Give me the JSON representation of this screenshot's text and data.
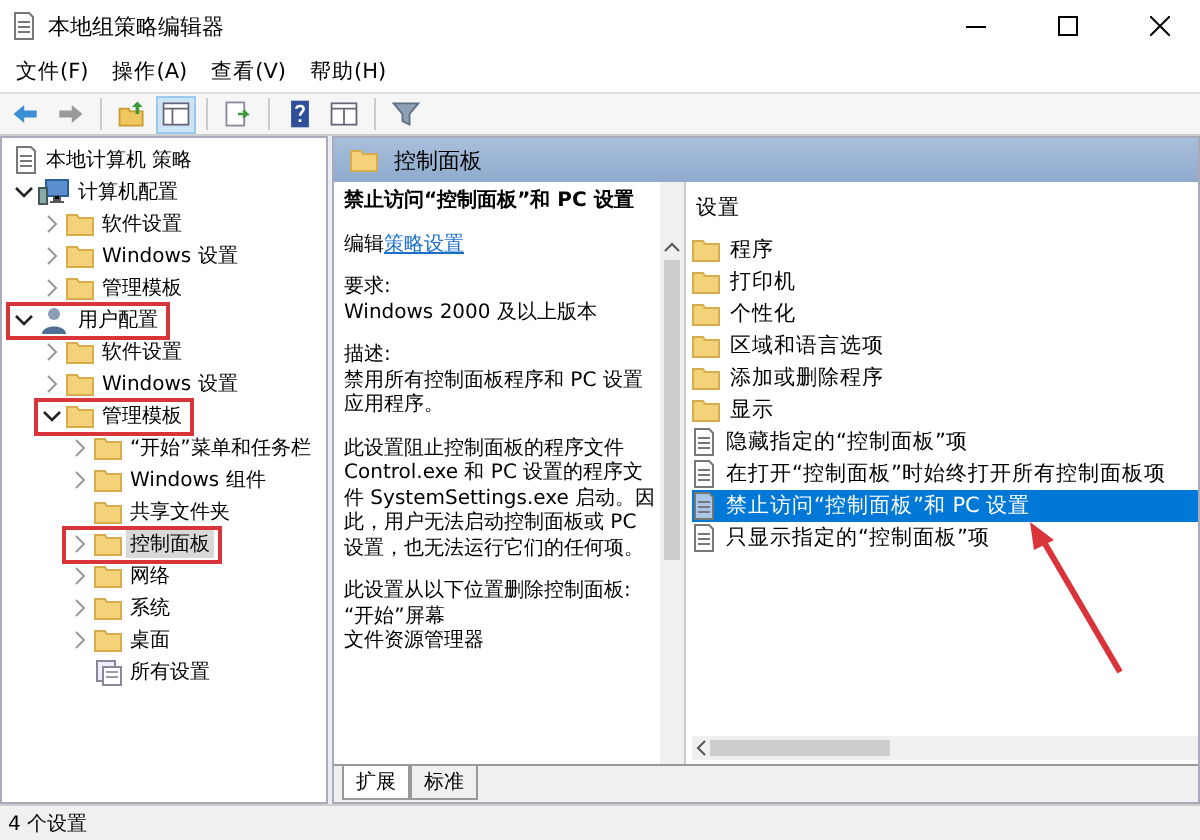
{
  "window": {
    "title": "本地组策略编辑器"
  },
  "menu": [
    "文件(F)",
    "操作(A)",
    "查看(V)",
    "帮助(H)"
  ],
  "toolbar": [
    {
      "kind": "back",
      "separator_before": false,
      "selected": false
    },
    {
      "kind": "forward",
      "separator_before": false,
      "selected": false
    },
    {
      "kind": "folder-up",
      "separator_before": true,
      "selected": false
    },
    {
      "kind": "tree",
      "separator_before": false,
      "selected": true
    },
    {
      "kind": "export",
      "separator_before": true,
      "selected": false
    },
    {
      "kind": "help",
      "separator_before": true,
      "selected": false
    },
    {
      "kind": "panel",
      "separator_before": false,
      "selected": false
    },
    {
      "kind": "filter",
      "separator_before": true,
      "selected": false
    }
  ],
  "tree": [
    {
      "label": "本地计算机 策略",
      "kind": "policy",
      "expandable": false,
      "selected": false,
      "annotated": false,
      "children": [
        {
          "label": "计算机配置",
          "kind": "computer",
          "expandable": true,
          "expanded": true,
          "selected": false,
          "annotated": false,
          "children": [
            {
              "label": "软件设置",
              "kind": "folder",
              "expandable": true,
              "expanded": false,
              "selected": false,
              "annotated": false
            },
            {
              "label": "Windows 设置",
              "kind": "folder",
              "expandable": true,
              "expanded": false,
              "selected": false,
              "annotated": false
            },
            {
              "label": "管理模板",
              "kind": "folder",
              "expandable": true,
              "expanded": false,
              "selected": false,
              "annotated": false
            }
          ]
        },
        {
          "label": "用户配置",
          "kind": "user",
          "expandable": true,
          "expanded": true,
          "selected": false,
          "annotated": true,
          "children": [
            {
              "label": "软件设置",
              "kind": "folder",
              "expandable": true,
              "expanded": false,
              "selected": false,
              "annotated": false
            },
            {
              "label": "Windows 设置",
              "kind": "folder",
              "expandable": true,
              "expanded": false,
              "selected": false,
              "annotated": false
            },
            {
              "label": "管理模板",
              "kind": "folder",
              "expandable": true,
              "expanded": true,
              "selected": false,
              "annotated": true,
              "children": [
                {
                  "label": "“开始”菜单和任务栏",
                  "kind": "folder",
                  "expandable": true,
                  "expanded": false,
                  "selected": false,
                  "annotated": false
                },
                {
                  "label": "Windows 组件",
                  "kind": "folder",
                  "expandable": true,
                  "expanded": false,
                  "selected": false,
                  "annotated": false
                },
                {
                  "label": "共享文件夹",
                  "kind": "folder",
                  "expandable": false,
                  "selected": false,
                  "annotated": false
                },
                {
                  "label": "控制面板",
                  "kind": "folder",
                  "expandable": true,
                  "expanded": false,
                  "selected": true,
                  "annotated": true
                },
                {
                  "label": "网络",
                  "kind": "folder",
                  "expandable": true,
                  "expanded": false,
                  "selected": false,
                  "annotated": false
                },
                {
                  "label": "系统",
                  "kind": "folder",
                  "expandable": true,
                  "expanded": false,
                  "selected": false,
                  "annotated": false
                },
                {
                  "label": "桌面",
                  "kind": "folder",
                  "expandable": true,
                  "expanded": false,
                  "selected": false,
                  "annotated": false
                },
                {
                  "label": "所有设置",
                  "kind": "all-settings",
                  "expandable": false,
                  "selected": false,
                  "annotated": false
                }
              ]
            }
          ]
        }
      ]
    }
  ],
  "header": {
    "title": "控制面板"
  },
  "description": {
    "title": "禁止访问“控制面板”和 PC 设置",
    "edit_prefix": "编辑",
    "edit_link": "策略设置",
    "sections": [
      [
        "要求:",
        "Windows 2000 及以上版本"
      ],
      [
        "描述:",
        "禁用所有控制面板程序和 PC 设置应用程序。"
      ],
      [
        "此设置阻止控制面板的程序文件 Control.exe 和 PC 设置的程序文件 SystemSettings.exe 启动。因此，用户无法启动控制面板或 PC 设置，也无法运行它们的任何项。"
      ],
      [
        "此设置从以下位置删除控制面板:",
        "“开始”屏幕",
        "文件资源管理器"
      ]
    ]
  },
  "settings": {
    "heading": "设置",
    "items": [
      {
        "label": "程序",
        "kind": "folder",
        "selected": false
      },
      {
        "label": "打印机",
        "kind": "folder",
        "selected": false
      },
      {
        "label": "个性化",
        "kind": "folder",
        "selected": false
      },
      {
        "label": "区域和语言选项",
        "kind": "folder",
        "selected": false
      },
      {
        "label": "添加或删除程序",
        "kind": "folder",
        "selected": false
      },
      {
        "label": "显示",
        "kind": "folder",
        "selected": false
      },
      {
        "label": "隐藏指定的“控制面板”项",
        "kind": "policy",
        "selected": false
      },
      {
        "label": "在打开“控制面板”时始终打开所有控制面板项",
        "kind": "policy",
        "selected": false
      },
      {
        "label": "禁止访问“控制面板”和 PC 设置",
        "kind": "policy",
        "selected": true
      },
      {
        "label": "只显示指定的“控制面板”项",
        "kind": "policy",
        "selected": false
      }
    ]
  },
  "tabs": [
    {
      "label": "扩展",
      "selected": true
    },
    {
      "label": "标准",
      "selected": false
    }
  ],
  "status_bar": "4 个设置"
}
